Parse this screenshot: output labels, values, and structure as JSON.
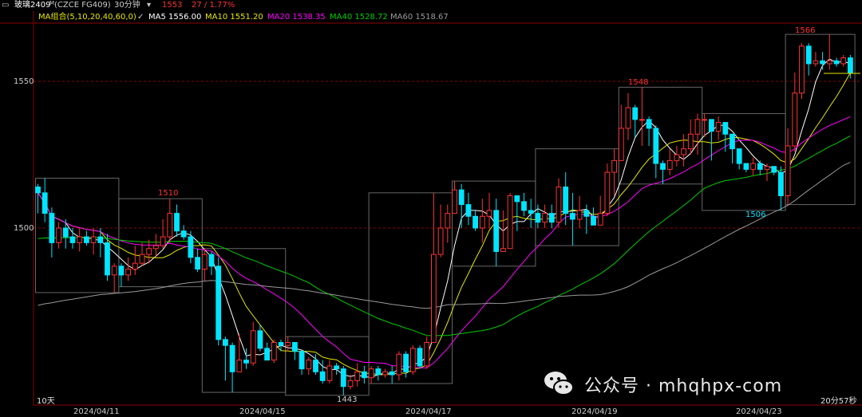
{
  "header": {
    "name": "玻璃2409",
    "superscript": "M",
    "code": "(CZCE FG409)",
    "period": "30分钟",
    "price": "1553",
    "change": "27 / 1.77%"
  },
  "ma_bar": {
    "group": "MA组合(5,10,20,40,60,0)",
    "ma5": "MA5 1556.00",
    "ma10": "MA10 1551.20",
    "ma20": "MA20 1538.35",
    "ma40": "MA40 1528.72",
    "ma60": "MA60 1518.67"
  },
  "footer": {
    "left": "10天",
    "right": "20分57秒"
  },
  "watermark": {
    "text": "公众号 · mhqhpx-com"
  },
  "colors": {
    "up": "#ff3333",
    "down": "#00e5ff",
    "ma5": "#ffffff",
    "ma10": "#e6e600",
    "ma20": "#ff00ff",
    "ma40": "#00cc00",
    "ma60": "#999999",
    "grid_red": "#8b0000",
    "price_red": "#ff3333"
  },
  "chart_data": {
    "type": "candlestick",
    "y_ticks": [
      "1550",
      "1500"
    ],
    "x_ticks": [
      "2024/04/11",
      "2024/04/15",
      "2024/04/17",
      "2024/04/19",
      "2024/04/23"
    ],
    "annotations": [
      {
        "label": "1510"
      },
      {
        "label": "1443"
      },
      {
        "label": "1548"
      },
      {
        "label": "1506"
      },
      {
        "label": "1566"
      }
    ],
    "candles": [
      [
        1514,
        1512,
        1515,
        1505
      ],
      [
        1512,
        1505,
        1517,
        1502
      ],
      [
        1505,
        1495,
        1507,
        1490
      ],
      [
        1495,
        1500,
        1502,
        1493
      ],
      [
        1500,
        1497,
        1503,
        1493
      ],
      [
        1497,
        1495,
        1500,
        1493
      ],
      [
        1495,
        1497,
        1500,
        1492
      ],
      [
        1497,
        1495,
        1499,
        1494
      ],
      [
        1495,
        1497,
        1500,
        1491
      ],
      [
        1497,
        1495,
        1500,
        1490
      ],
      [
        1495,
        1484,
        1498,
        1482
      ],
      [
        1484,
        1487,
        1488,
        1478
      ],
      [
        1487,
        1484,
        1488,
        1480
      ],
      [
        1484,
        1486,
        1490,
        1482
      ],
      [
        1486,
        1488,
        1494,
        1484
      ],
      [
        1488,
        1491,
        1495,
        1487
      ],
      [
        1491,
        1493,
        1496,
        1488
      ],
      [
        1493,
        1494,
        1498,
        1490
      ],
      [
        1494,
        1497,
        1503,
        1493
      ],
      [
        1497,
        1505,
        1510,
        1495
      ],
      [
        1505,
        1499,
        1508,
        1497
      ],
      [
        1499,
        1497,
        1501,
        1496
      ],
      [
        1497,
        1490,
        1499,
        1488
      ],
      [
        1490,
        1486,
        1493,
        1485
      ],
      [
        1486,
        1491,
        1493,
        1482
      ],
      [
        1491,
        1487,
        1492,
        1484
      ],
      [
        1487,
        1462,
        1490,
        1460
      ],
      [
        1462,
        1460,
        1463,
        1448
      ],
      [
        1460,
        1451,
        1461,
        1444
      ],
      [
        1451,
        1455,
        1464,
        1453
      ],
      [
        1455,
        1454,
        1459,
        1452
      ],
      [
        1454,
        1465,
        1468,
        1453
      ],
      [
        1465,
        1459,
        1467,
        1458
      ],
      [
        1459,
        1455,
        1461,
        1455
      ],
      [
        1455,
        1461,
        1462,
        1454
      ],
      [
        1461,
        1460,
        1462,
        1458
      ],
      [
        1460,
        1461,
        1463,
        1458
      ],
      [
        1461,
        1458,
        1461,
        1455
      ],
      [
        1458,
        1452,
        1458,
        1450
      ],
      [
        1452,
        1455,
        1456,
        1450
      ],
      [
        1455,
        1451,
        1457,
        1450
      ],
      [
        1451,
        1448,
        1455,
        1447
      ],
      [
        1448,
        1453,
        1455,
        1447
      ],
      [
        1453,
        1452,
        1454,
        1450
      ],
      [
        1452,
        1446,
        1453,
        1443
      ],
      [
        1446,
        1448,
        1450,
        1445
      ],
      [
        1448,
        1451,
        1454,
        1446
      ],
      [
        1451,
        1449,
        1453,
        1447
      ],
      [
        1449,
        1452,
        1453,
        1447
      ],
      [
        1452,
        1450,
        1453,
        1448
      ],
      [
        1450,
        1451,
        1452,
        1449
      ],
      [
        1451,
        1450,
        1453,
        1447
      ],
      [
        1450,
        1457,
        1458,
        1448
      ],
      [
        1457,
        1451,
        1458,
        1449
      ],
      [
        1451,
        1459,
        1460,
        1450
      ],
      [
        1459,
        1453,
        1460,
        1452
      ],
      [
        1453,
        1461,
        1463,
        1452
      ],
      [
        1461,
        1491,
        1512,
        1461
      ],
      [
        1491,
        1500,
        1508,
        1490
      ],
      [
        1500,
        1505,
        1508,
        1495
      ],
      [
        1505,
        1513,
        1516,
        1505
      ],
      [
        1513,
        1508,
        1515,
        1500
      ],
      [
        1508,
        1504,
        1512,
        1501
      ],
      [
        1504,
        1500,
        1506,
        1499
      ],
      [
        1500,
        1504,
        1510,
        1495
      ],
      [
        1504,
        1506,
        1512,
        1500
      ],
      [
        1506,
        1492,
        1510,
        1487
      ],
      [
        1492,
        1493,
        1506,
        1493
      ],
      [
        1493,
        1511,
        1512,
        1495
      ],
      [
        1511,
        1509,
        1511,
        1499
      ],
      [
        1509,
        1506,
        1512,
        1504
      ],
      [
        1506,
        1505,
        1510,
        1500
      ],
      [
        1505,
        1502,
        1508,
        1500
      ],
      [
        1502,
        1505,
        1508,
        1500
      ],
      [
        1505,
        1502,
        1508,
        1500
      ],
      [
        1502,
        1514,
        1517,
        1500
      ],
      [
        1514,
        1505,
        1519,
        1501
      ],
      [
        1505,
        1503,
        1512,
        1494
      ],
      [
        1503,
        1506,
        1511,
        1500
      ],
      [
        1506,
        1504,
        1508,
        1498
      ],
      [
        1504,
        1501,
        1507,
        1501
      ],
      [
        1501,
        1505,
        1511,
        1501
      ],
      [
        1505,
        1519,
        1522,
        1504
      ],
      [
        1519,
        1523,
        1527,
        1511
      ],
      [
        1523,
        1534,
        1542,
        1523
      ],
      [
        1534,
        1541,
        1546,
        1530
      ],
      [
        1541,
        1537,
        1542,
        1531
      ],
      [
        1537,
        1537,
        1548,
        1528
      ],
      [
        1537,
        1534,
        1538,
        1528
      ],
      [
        1534,
        1522,
        1535,
        1517
      ],
      [
        1522,
        1520,
        1523,
        1515
      ],
      [
        1520,
        1523,
        1527,
        1518
      ],
      [
        1523,
        1525,
        1528,
        1521
      ],
      [
        1525,
        1527,
        1532,
        1521
      ],
      [
        1527,
        1532,
        1537,
        1525
      ],
      [
        1532,
        1537,
        1539,
        1525
      ],
      [
        1537,
        1537,
        1539,
        1531
      ],
      [
        1537,
        1533,
        1537,
        1523
      ],
      [
        1533,
        1536,
        1538,
        1530
      ],
      [
        1536,
        1532,
        1534,
        1526
      ],
      [
        1532,
        1527,
        1530,
        1522
      ],
      [
        1527,
        1522,
        1523,
        1520
      ],
      [
        1522,
        1520,
        1522,
        1519
      ],
      [
        1520,
        1522,
        1524,
        1518
      ],
      [
        1522,
        1520,
        1523,
        1518
      ],
      [
        1520,
        1521,
        1522,
        1516
      ],
      [
        1521,
        1519,
        1521,
        1518
      ],
      [
        1519,
        1511,
        1521,
        1506
      ],
      [
        1511,
        1528,
        1534,
        1508
      ],
      [
        1528,
        1546,
        1553,
        1526
      ],
      [
        1546,
        1562,
        1563,
        1544
      ],
      [
        1562,
        1556,
        1563,
        1552
      ],
      [
        1556,
        1557,
        1560,
        1555
      ],
      [
        1557,
        1556,
        1560,
        1554
      ],
      [
        1556,
        1557,
        1566,
        1554
      ],
      [
        1557,
        1556,
        1558,
        1555
      ],
      [
        1556,
        1558,
        1559,
        1555
      ],
      [
        1558,
        1553,
        1559,
        1551
      ]
    ]
  }
}
